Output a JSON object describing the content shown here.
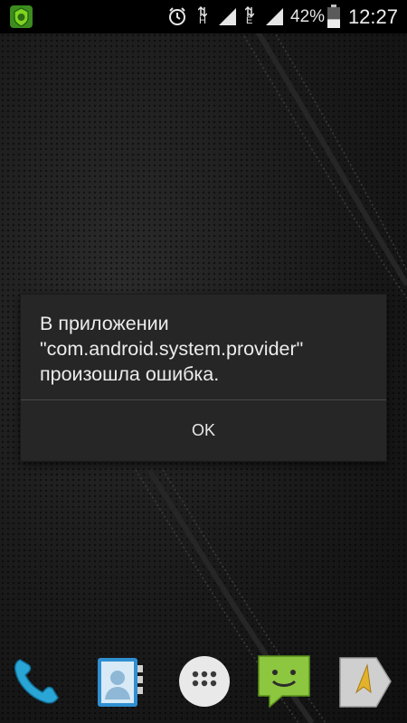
{
  "status_bar": {
    "network_labels": [
      "H",
      "E"
    ],
    "battery_percent_text": "42%",
    "battery_level": 0.42,
    "time": "12:27",
    "icons": [
      "security-app-icon",
      "alarm-icon",
      "data-activity-icon",
      "signal-icon",
      "data-activity-icon",
      "signal-icon",
      "battery-icon"
    ]
  },
  "dialog": {
    "message": "В приложении\n\"com.android.system.provider\"\nпроизошла ошибка.",
    "ok_label": "OK"
  },
  "dock": {
    "items": [
      "phone-icon",
      "contacts-icon",
      "app-drawer-icon",
      "messages-icon",
      "navigation-icon"
    ]
  }
}
